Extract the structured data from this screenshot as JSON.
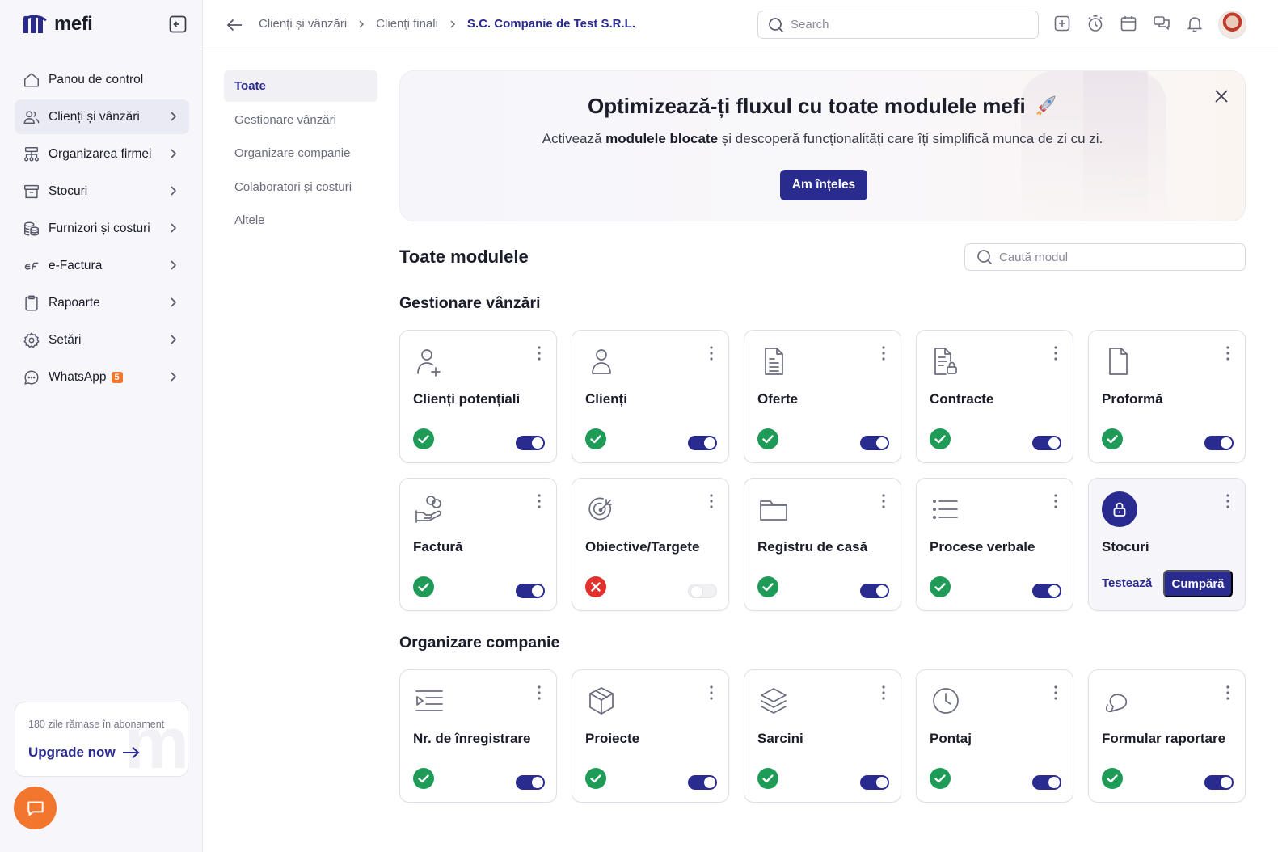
{
  "app": {
    "name": "mefi"
  },
  "sidebar": {
    "items": [
      {
        "label": "Panou de control",
        "icon": "home-icon"
      },
      {
        "label": "Clienți și vânzări",
        "icon": "users-icon"
      },
      {
        "label": "Organizarea firmei",
        "icon": "org-chart-icon"
      },
      {
        "label": "Stocuri",
        "icon": "archive-box-icon"
      },
      {
        "label": "Furnizori și costuri",
        "icon": "coins-icon"
      },
      {
        "label": "e-Factura",
        "icon": "efactura-icon"
      },
      {
        "label": "Rapoarte",
        "icon": "clipboard-icon"
      },
      {
        "label": "Setări",
        "icon": "gear-icon"
      },
      {
        "label": "WhatsApp",
        "icon": "chat-bubble-icon",
        "badge": "5"
      }
    ],
    "upgrade": {
      "remaining": "180 zile rămase în abonament",
      "link": "Upgrade now"
    }
  },
  "topbar": {
    "breadcrumbs": [
      "Clienți și vânzări",
      "Clienți finali",
      "S.C. Companie de Test S.R.L."
    ],
    "search_placeholder": "Search"
  },
  "subnav": [
    "Toate",
    "Gestionare vânzări",
    "Organizare companie",
    "Colaboratori și costuri",
    "Altele"
  ],
  "banner": {
    "title": "Optimizează-ți fluxul cu toate modulele mefi",
    "text_before": "Activează ",
    "text_bold": "modulele blocate",
    "text_after": " și descoperă funcționalități care îți simplifică munca de zi cu zi.",
    "button": "Am înțeles"
  },
  "modules": {
    "title": "Toate modulele",
    "search_placeholder": "Caută modul",
    "groups": [
      {
        "title": "Gestionare vânzări",
        "items": [
          {
            "name": "Clienți potențiali",
            "icon": "user-plus-icon",
            "status": "active",
            "enabled": true
          },
          {
            "name": "Clienți",
            "icon": "user-icon",
            "status": "active",
            "enabled": true
          },
          {
            "name": "Oferte",
            "icon": "document-icon",
            "status": "active",
            "enabled": true
          },
          {
            "name": "Contracte",
            "icon": "contract-lock-icon",
            "status": "active",
            "enabled": true
          },
          {
            "name": "Proformă",
            "icon": "file-icon",
            "status": "active",
            "enabled": true
          },
          {
            "name": "Factură",
            "icon": "hand-coins-icon",
            "status": "active",
            "enabled": true
          },
          {
            "name": "Obiective/Targete",
            "icon": "target-icon",
            "status": "inactive",
            "enabled": false
          },
          {
            "name": "Registru de casă",
            "icon": "folder-icon",
            "status": "active",
            "enabled": true
          },
          {
            "name": "Procese verbale",
            "icon": "list-icon",
            "status": "active",
            "enabled": true
          },
          {
            "name": "Stocuri",
            "icon": "lock-icon",
            "status": "locked",
            "try_label": "Testează",
            "buy_label": "Cumpără"
          }
        ]
      },
      {
        "title": "Organizare companie",
        "items": [
          {
            "name": "Nr. de înregistrare",
            "icon": "register-list-icon",
            "status": "active",
            "enabled": true
          },
          {
            "name": "Proiecte",
            "icon": "box-icon",
            "status": "active",
            "enabled": true
          },
          {
            "name": "Sarcini",
            "icon": "layers-icon",
            "status": "active",
            "enabled": true
          },
          {
            "name": "Pontaj",
            "icon": "clock-icon",
            "status": "active",
            "enabled": true
          },
          {
            "name": "Formular raportare",
            "icon": "speech-bubbles-icon",
            "status": "active",
            "enabled": true
          }
        ]
      }
    ]
  },
  "colors": {
    "primary": "#2a2b8f",
    "success": "#1e9b57",
    "danger": "#e2312c",
    "accent": "#f2762e"
  }
}
